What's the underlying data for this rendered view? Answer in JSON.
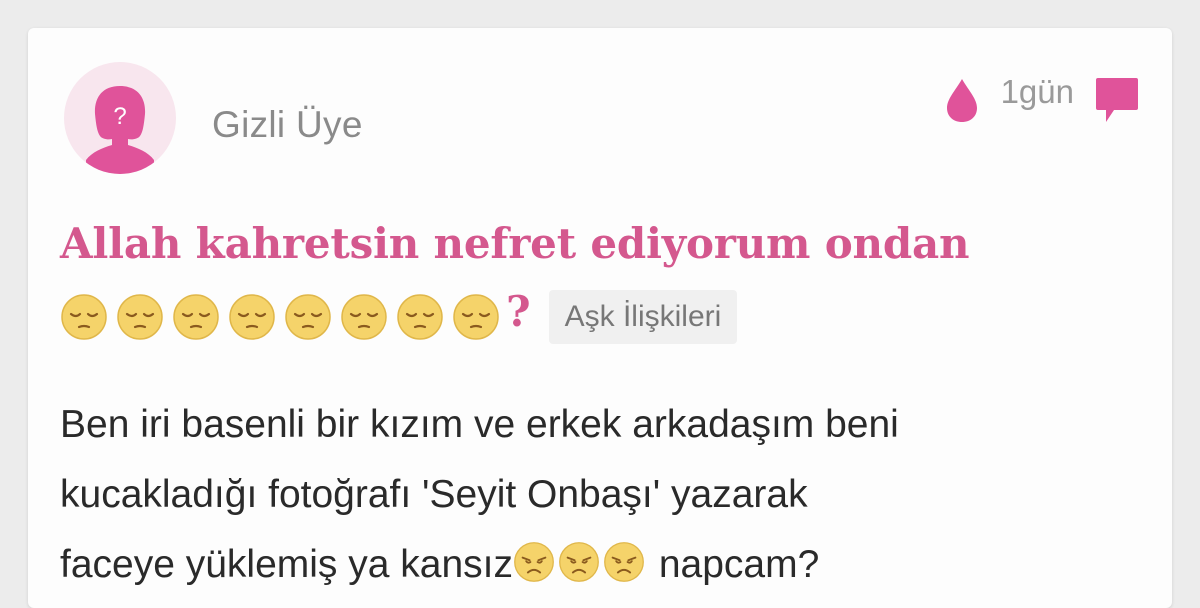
{
  "post": {
    "author": "Gizli Üye",
    "time": "1gün",
    "title": "Allah kahretsin nefret ediyorum ondan",
    "title_suffix": "?",
    "category": "Aşk İlişkileri",
    "body_line1": "Ben iri basenli bir kızım ve erkek arkadaşım beni",
    "body_line2": "kucakladığı fotoğrafı 'Seyit Onbaşı' yazarak",
    "body_line3_start": "faceye yüklemiş ya kansız",
    "body_line3_end": " napcam?"
  },
  "icons": {
    "avatar": "anonymous-female-avatar-icon",
    "drop": "drop-icon",
    "comment": "comment-icon",
    "title_emoji": "pensive-face-emoji",
    "body_emoji": "disappointed-face-emoji"
  },
  "colors": {
    "accent": "#e0539a",
    "title": "#d4588e",
    "avatar_bg": "#f8e6ee"
  },
  "counts": {
    "title_emoji_count": 8,
    "body_emoji_count": 3
  }
}
